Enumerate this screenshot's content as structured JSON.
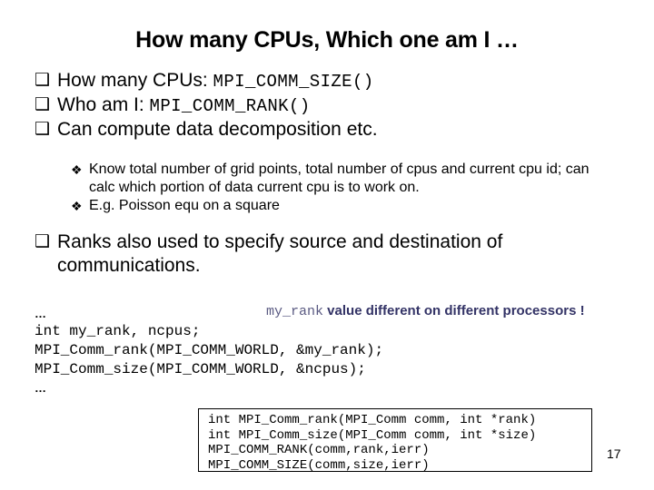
{
  "slide": {
    "title": "How many CPUs, Which one am I …",
    "page_number": "17"
  },
  "bullets": [
    {
      "marker": "❑",
      "text": "How many CPUs: ",
      "code": "MPI_COMM_SIZE()"
    },
    {
      "marker": "❑",
      "text": "Who am I: ",
      "code": "MPI_COMM_RANK()"
    },
    {
      "marker": "❑",
      "text": "Can compute data decomposition etc.",
      "code": ""
    }
  ],
  "sub_bullets": [
    {
      "marker": "❖",
      "text": "Know total number of grid points, total number of cpus and current cpu id; can calc which portion of data current cpu is to work on."
    },
    {
      "marker": "❖",
      "text": "E.g. Poisson equ on a square"
    }
  ],
  "bullet_last": {
    "marker": "❑",
    "text": "Ranks also used to specify source and destination of communications."
  },
  "annotation": {
    "mono_part": "my_rank",
    "note_part": " value different on different processors !",
    "mono_color": "#5a5a82",
    "note_color": "#333366"
  },
  "code_block": {
    "ellipsis_top": "…",
    "lines": [
      "int my_rank, ncpus;",
      "MPI_Comm_rank(MPI_COMM_WORLD, &my_rank);",
      "MPI_Comm_size(MPI_COMM_WORLD, &ncpus);"
    ],
    "ellipsis_bottom": "…"
  },
  "code_box": {
    "lines": [
      "int MPI_Comm_rank(MPI_Comm comm, int *rank)",
      "int MPI_Comm_size(MPI_Comm comm, int *size)",
      "MPI_COMM_RANK(comm,rank,ierr)",
      "MPI_COMM_SIZE(comm,size,ierr)"
    ]
  }
}
